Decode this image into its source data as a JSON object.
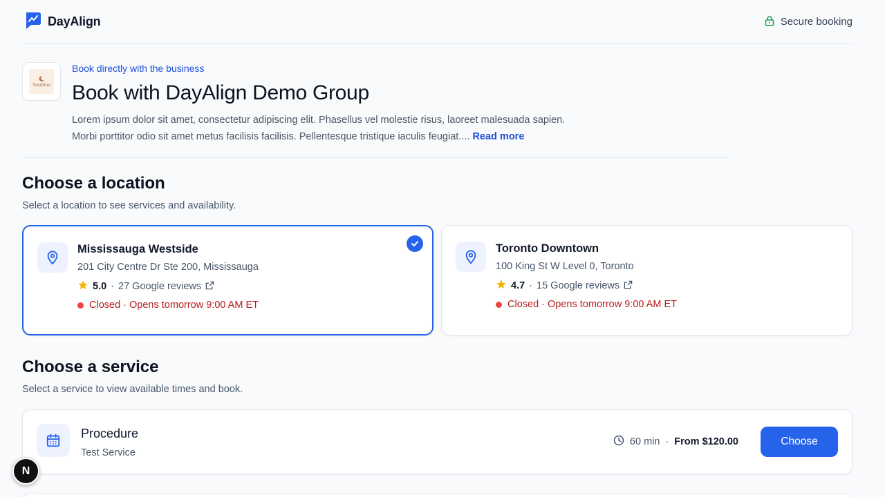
{
  "header": {
    "brand_name": "DayAlign",
    "secure_label": "Secure booking"
  },
  "hero": {
    "logo_text": "Tendlina",
    "eyebrow": "Book directly with the business",
    "title": "Book with DayAlign Demo Group",
    "description": "Lorem ipsum dolor sit amet, consectetur adipiscing elit. Phasellus vel molestie risus, laoreet malesuada sapien. Morbi porttitor odio sit amet metus facilisis facilisis. Pellentesque tristique iaculis feugiat....",
    "read_more": "Read more"
  },
  "location_section": {
    "title": "Choose a location",
    "subtitle": "Select a location to see services and availability.",
    "locations": [
      {
        "name": "Mississauga Westside",
        "address": "201 City Centre Dr Ste 200, Mississauga",
        "rating": "5.0",
        "separator": "·",
        "reviews": "27 Google reviews",
        "status": "Closed · Opens tomorrow 9:00 AM ET",
        "selected": true
      },
      {
        "name": "Toronto Downtown",
        "address": "100 King St W Level 0, Toronto",
        "rating": "4.7",
        "separator": "·",
        "reviews": "15 Google reviews",
        "status": "Closed · Opens tomorrow 9:00 AM ET",
        "selected": false
      }
    ]
  },
  "service_section": {
    "title": "Choose a service",
    "subtitle": "Select a service to view available times and book.",
    "services": [
      {
        "name": "Procedure",
        "description": "Test Service",
        "duration": "60 min",
        "separator": "·",
        "price": "From $120.00",
        "button_label": "Choose"
      }
    ]
  },
  "fab_label": "N",
  "colors": {
    "accent": "#2563eb",
    "link": "#1d4ed8",
    "closed": "#b91c1c",
    "closed_dot": "#ef4444",
    "star": "#f5b400",
    "secure_icon": "#16a34a"
  },
  "icons": {
    "brand": "brand-logo-icon",
    "secure": "lock-icon",
    "location": "map-pin-icon",
    "selected": "check-icon",
    "rating": "star-icon",
    "reviews": "external-link-icon",
    "service": "calendar-icon",
    "duration": "clock-icon"
  }
}
